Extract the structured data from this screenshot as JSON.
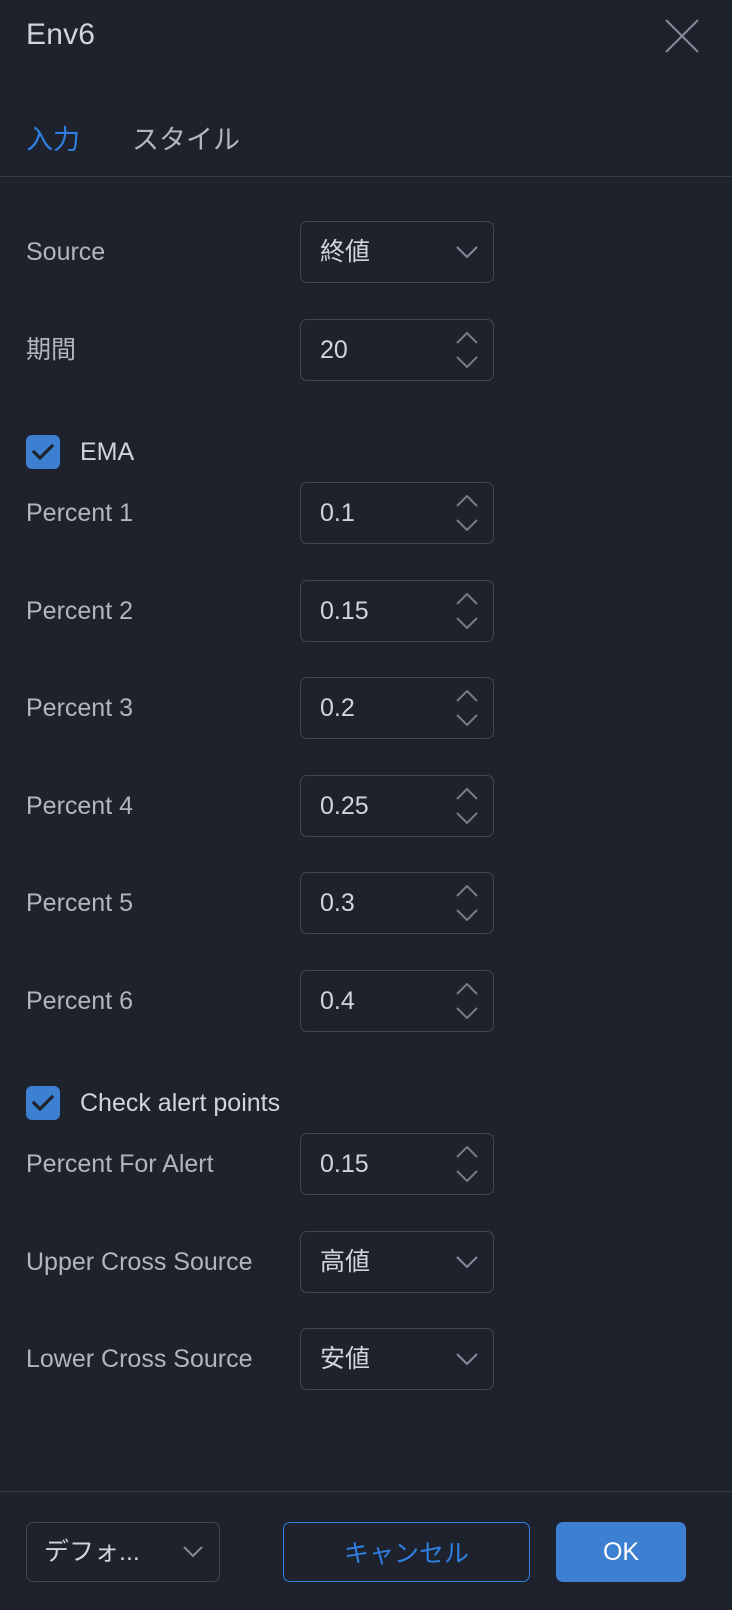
{
  "header": {
    "title": "Env6",
    "close_icon": "close-icon"
  },
  "tabs": [
    {
      "label": "入力",
      "active": true
    },
    {
      "label": "スタイル",
      "active": false
    }
  ],
  "colors": {
    "background": "#1e222d",
    "accent": "#3d7fd1",
    "tab_active": "#2f7ee0",
    "border": "#434651",
    "divider": "#363a45",
    "label_text": "#b2b5be",
    "value_text": "#d1d4dc"
  },
  "inputs": {
    "source": {
      "label": "Source",
      "value": "終値",
      "type": "select",
      "icon": "chevron-down-icon"
    },
    "length": {
      "label": "期間",
      "value": "20",
      "type": "number",
      "icon": "spinner-icon"
    },
    "ema": {
      "label": "EMA",
      "checked": true,
      "type": "checkbox"
    },
    "percents": [
      {
        "label": "Percent 1",
        "value": "0.1",
        "type": "number"
      },
      {
        "label": "Percent 2",
        "value": "0.15",
        "type": "number"
      },
      {
        "label": "Percent 3",
        "value": "0.2",
        "type": "number"
      },
      {
        "label": "Percent 4",
        "value": "0.25",
        "type": "number"
      },
      {
        "label": "Percent 5",
        "value": "0.3",
        "type": "number"
      },
      {
        "label": "Percent 6",
        "value": "0.4",
        "type": "number"
      }
    ],
    "check_alert_points": {
      "label": "Check alert points",
      "checked": true,
      "type": "checkbox"
    },
    "percent_for_alert": {
      "label": "Percent For Alert",
      "value": "0.15",
      "type": "number"
    },
    "upper_cross_source": {
      "label": "Upper Cross Source",
      "value": "高値",
      "type": "select",
      "icon": "chevron-down-icon"
    },
    "lower_cross_source": {
      "label": "Lower Cross Source",
      "value": "安値",
      "type": "select",
      "icon": "chevron-down-icon"
    }
  },
  "footer": {
    "defaults_label": "デフォ...",
    "defaults_icon": "chevron-down-icon",
    "cancel_label": "キャンセル",
    "ok_label": "OK"
  }
}
